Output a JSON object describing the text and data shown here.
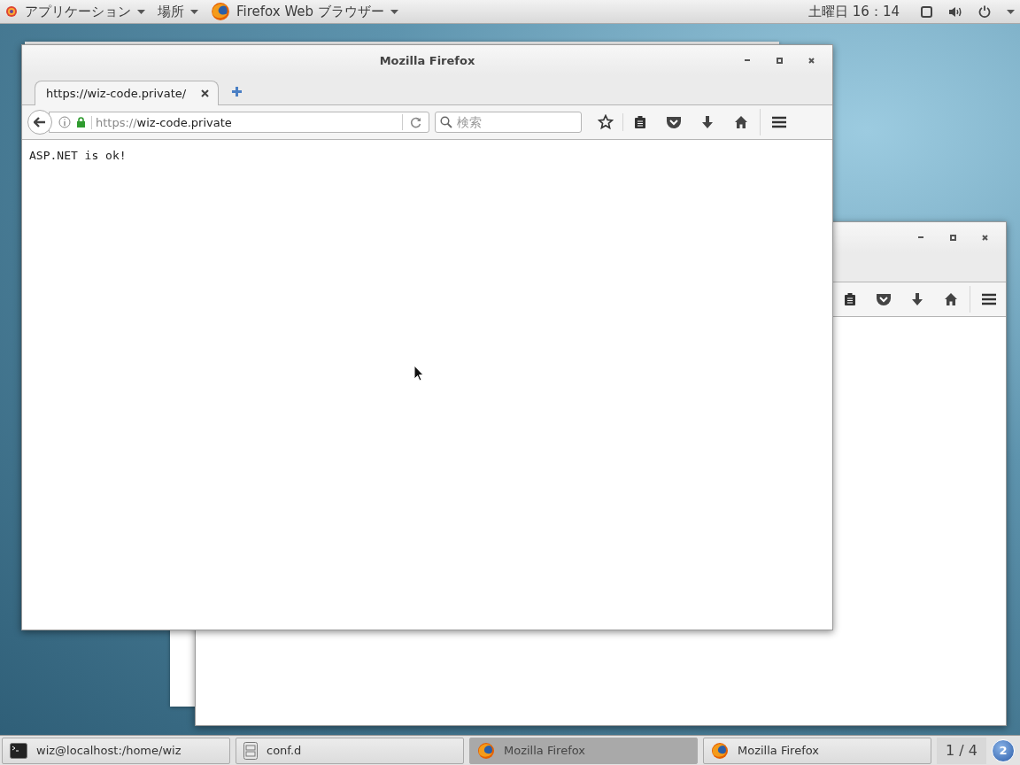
{
  "top_bar": {
    "apps_menu": "アプリケーション",
    "places_menu": "場所",
    "active_app": "Firefox Web ブラウザー",
    "day": "土曜日",
    "time": "16：14"
  },
  "browser": {
    "title": "Mozilla Firefox",
    "tabs": [
      {
        "label": "https://wiz-code.private/",
        "selected": true
      }
    ],
    "url_scheme": "https://",
    "url_host": "wiz-code.private",
    "search": {
      "placeholder": "検索"
    },
    "page_text": "ASP.NET is ok!"
  },
  "taskbar": {
    "items": [
      {
        "kind": "terminal",
        "label": "wiz@localhost:/home/wiz",
        "selected": false
      },
      {
        "kind": "files",
        "label": "conf.d",
        "selected": false
      },
      {
        "kind": "firefox",
        "label": "Mozilla Firefox",
        "selected": true
      },
      {
        "kind": "firefox",
        "label": "Mozilla Firefox",
        "selected": false
      }
    ],
    "workspace": "1 / 4",
    "notifications": "2"
  }
}
